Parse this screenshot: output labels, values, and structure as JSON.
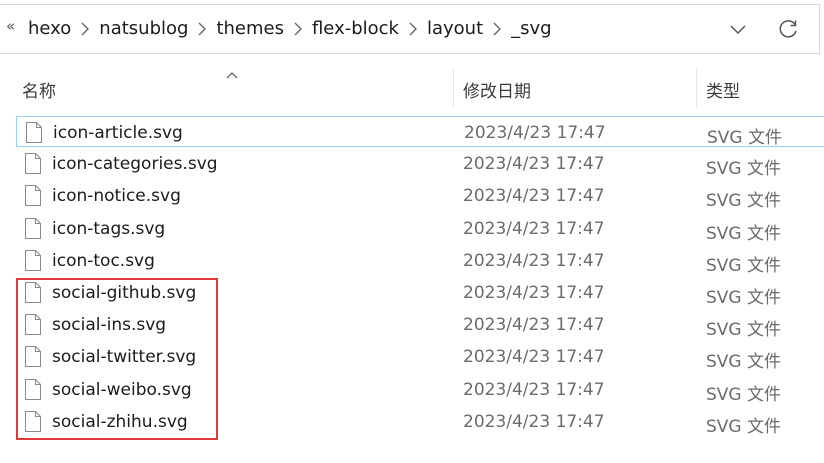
{
  "address_bar": {
    "overflow_glyph": "«",
    "breadcrumbs": [
      "hexo",
      "natsublog",
      "themes",
      "flex-block",
      "layout",
      "_svg"
    ],
    "dropdown_icon": "chevron-down-icon",
    "refresh_icon": "refresh-icon"
  },
  "columns": {
    "name": "名称",
    "date": "修改日期",
    "type": "类型"
  },
  "files": [
    {
      "name": "icon-article.svg",
      "date": "2023/4/23 17:47",
      "type": "SVG 文件"
    },
    {
      "name": "icon-categories.svg",
      "date": "2023/4/23 17:47",
      "type": "SVG 文件"
    },
    {
      "name": "icon-notice.svg",
      "date": "2023/4/23 17:47",
      "type": "SVG 文件"
    },
    {
      "name": "icon-tags.svg",
      "date": "2023/4/23 17:47",
      "type": "SVG 文件"
    },
    {
      "name": "icon-toc.svg",
      "date": "2023/4/23 17:47",
      "type": "SVG 文件"
    },
    {
      "name": "social-github.svg",
      "date": "2023/4/23 17:47",
      "type": "SVG 文件"
    },
    {
      "name": "social-ins.svg",
      "date": "2023/4/23 17:47",
      "type": "SVG 文件"
    },
    {
      "name": "social-twitter.svg",
      "date": "2023/4/23 17:47",
      "type": "SVG 文件"
    },
    {
      "name": "social-weibo.svg",
      "date": "2023/4/23 17:47",
      "type": "SVG 文件"
    },
    {
      "name": "social-zhihu.svg",
      "date": "2023/4/23 17:47",
      "type": "SVG 文件"
    }
  ],
  "colors": {
    "selection_border": "#99d1ff",
    "annotation_red": "#e03a3a"
  }
}
